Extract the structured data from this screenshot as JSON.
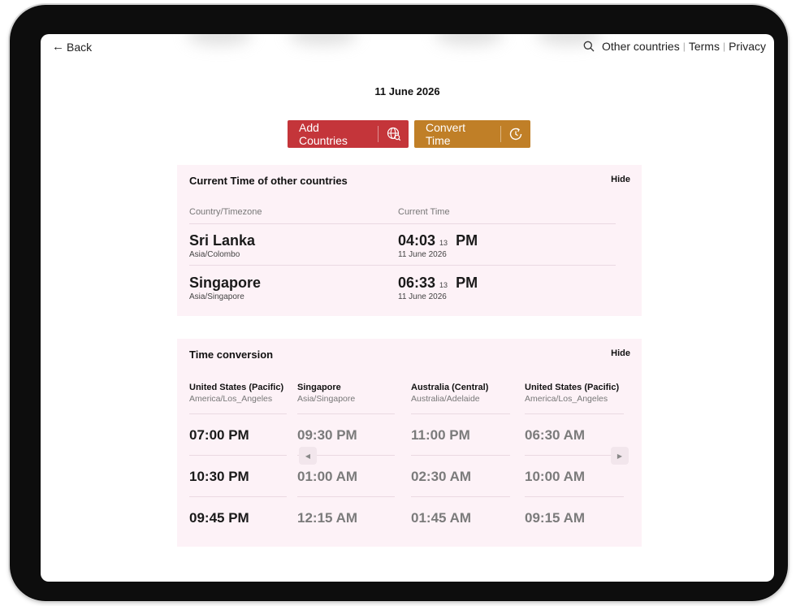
{
  "topbar": {
    "back_label": "Back",
    "links": [
      "Other countries",
      "Terms",
      "Privacy"
    ]
  },
  "date": "11 June 2026",
  "buttons": {
    "add_countries": "Add Countries",
    "convert_time": "Convert Time"
  },
  "colors": {
    "add_button": "#c4353a",
    "convert_button": "#c07f27",
    "panel_bg": "#fdf2f7"
  },
  "current_time": {
    "title": "Current Time of other countries",
    "hide_label": "Hide",
    "col_country": "Country/Timezone",
    "col_time": "Current Time",
    "rows": [
      {
        "country": "Sri Lanka",
        "timezone": "Asia/Colombo",
        "time": "04:03",
        "seconds": "13",
        "ampm": "PM",
        "date": "11 June 2026"
      },
      {
        "country": "Singapore",
        "timezone": "Asia/Singapore",
        "time": "06:33",
        "seconds": "13",
        "ampm": "PM",
        "date": "11 June 2026"
      }
    ]
  },
  "conversion": {
    "title": "Time conversion",
    "hide_label": "Hide",
    "columns": [
      {
        "name": "United States (Pacific)",
        "timezone": "America/Los_Angeles",
        "times": [
          "07:00 PM",
          "10:30 PM",
          "09:45 PM"
        ]
      },
      {
        "name": "Singapore",
        "timezone": "Asia/Singapore",
        "times": [
          "09:30 PM",
          "01:00 AM",
          "12:15 AM"
        ]
      },
      {
        "name": "Australia (Central)",
        "timezone": "Australia/Adelaide",
        "times": [
          "11:00 PM",
          "02:30 AM",
          "01:45 AM"
        ]
      },
      {
        "name": "United States (Pacific)",
        "timezone": "America/Los_Angeles",
        "times": [
          "06:30 AM",
          "10:00 AM",
          "09:15 AM"
        ]
      }
    ]
  }
}
